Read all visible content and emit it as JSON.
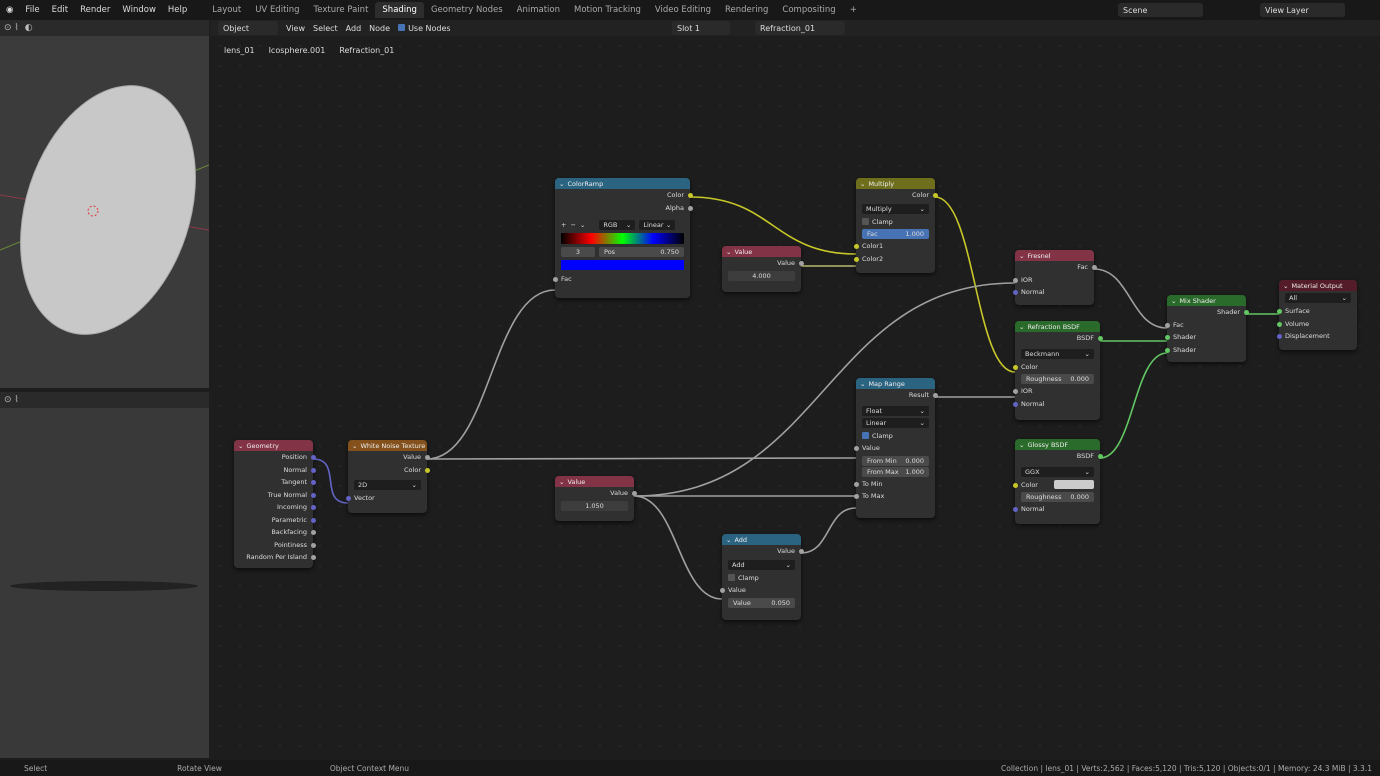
{
  "menu": [
    "File",
    "Edit",
    "Render",
    "Window",
    "Help"
  ],
  "workspaces": [
    "Layout",
    "UV Editing",
    "Texture Paint",
    "Shading",
    "Geometry Nodes",
    "Animation",
    "Motion Tracking",
    "Video Editing",
    "Rendering",
    "Compositing"
  ],
  "active_workspace": "Shading",
  "scene": "Scene",
  "view_layer": "View Layer",
  "node_header": {
    "mode": "Object",
    "menus": [
      "View",
      "Select",
      "Add",
      "Node"
    ],
    "use_nodes": "Use Nodes",
    "slot": "Slot 1",
    "material": "Refraction_01"
  },
  "breadcrumb": [
    "lens_01",
    "Icosphere.001",
    "Refraction_01"
  ],
  "nodes": {
    "colorramp": {
      "title": "ColorRamp",
      "out": [
        "Color",
        "Alpha"
      ],
      "mode": "RGB",
      "interp": "Linear",
      "index": "3",
      "pos_label": "Pos",
      "pos": "0.750",
      "in": "Fac",
      "selected_color": "#0000ff"
    },
    "multiply": {
      "title": "Multiply",
      "out": "Color",
      "op": "Multiply",
      "clamp": "Clamp",
      "fac_label": "Fac",
      "fac": "1.000",
      "in": [
        "Color1",
        "Color2"
      ]
    },
    "value1": {
      "title": "Value",
      "out": "Value",
      "value": "4.000"
    },
    "fresnel": {
      "title": "Fresnel",
      "out": "Fac",
      "in": [
        "IOR",
        "Normal"
      ]
    },
    "refraction": {
      "title": "Refraction BSDF",
      "out": "BSDF",
      "dist": "Beckmann",
      "in": [
        "Color",
        "IOR",
        "Normal"
      ],
      "rough_label": "Roughness",
      "rough": "0.000"
    },
    "mix": {
      "title": "Mix Shader",
      "out": "Shader",
      "in": [
        "Fac",
        "Shader",
        "Shader"
      ]
    },
    "output": {
      "title": "Material Output",
      "target": "All",
      "in": [
        "Surface",
        "Volume",
        "Displacement"
      ]
    },
    "maprange": {
      "title": "Map Range",
      "out": "Result",
      "type": "Float",
      "interp": "Linear",
      "clamp": "Clamp",
      "in_value": "Value",
      "from_min_label": "From Min",
      "from_min": "0.000",
      "from_max_label": "From Max",
      "from_max": "1.000",
      "to_min": "To Min",
      "to_max": "To Max"
    },
    "glossy": {
      "title": "Glossy BSDF",
      "out": "BSDF",
      "dist": "GGX",
      "color_label": "Color",
      "rough_label": "Roughness",
      "rough": "0.000",
      "normal": "Normal"
    },
    "geometry": {
      "title": "Geometry",
      "out": [
        "Position",
        "Normal",
        "Tangent",
        "True Normal",
        "Incoming",
        "Parametric",
        "Backfacing",
        "Pointiness",
        "Random Per Island"
      ]
    },
    "noise": {
      "title": "White Noise Texture",
      "out": [
        "Value",
        "Color"
      ],
      "dim": "2D",
      "in": "Vector"
    },
    "value2": {
      "title": "Value",
      "out": "Value",
      "value": "1.050"
    },
    "add": {
      "title": "Add",
      "out": "Value",
      "op": "Add",
      "clamp": "Clamp",
      "in": "Value",
      "val_label": "Value",
      "val": "0.050"
    }
  },
  "status": {
    "left": [
      "Select",
      "Rotate View",
      "Object Context Menu"
    ],
    "right": "Collection | lens_01 | Verts:2,562 | Faces:5,120 | Tris:5,120 | Objects:0/1 | Memory: 24.3 MiB | 3.3.1"
  }
}
